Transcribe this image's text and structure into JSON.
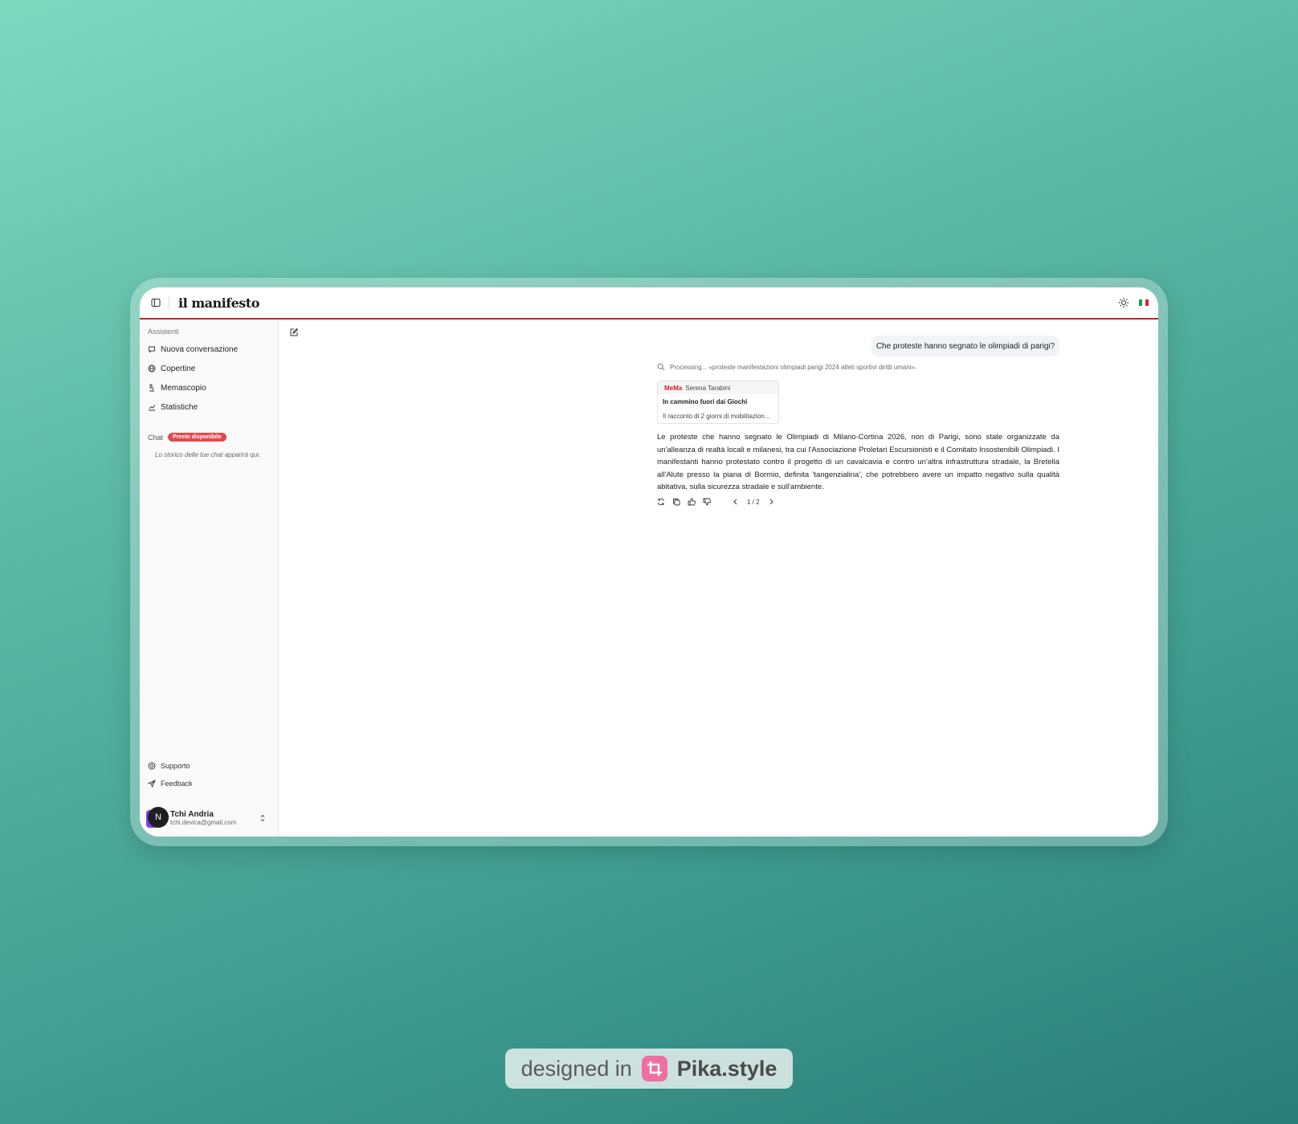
{
  "header": {
    "logo": "il manifesto",
    "flag_colors": [
      "#1b9a4a",
      "#ffffff",
      "#d52b2b"
    ]
  },
  "sidebar": {
    "heading": "Assistenti",
    "items": [
      {
        "label": "Nuova conversazione",
        "icon": "chat-plus-icon"
      },
      {
        "label": "Copertine",
        "icon": "globe-icon"
      },
      {
        "label": "Memascopio",
        "icon": "microscope-icon"
      },
      {
        "label": "Statistiche",
        "icon": "chart-icon"
      }
    ],
    "chat_label": "Chat",
    "chat_badge": "Presto disponibile",
    "empty_note": "Lo storico delle tue chat apparirà qui.",
    "support_label": "Supporto",
    "feedback_label": "Feedback",
    "user": {
      "initial": "N",
      "name": "Tchi Andria",
      "email": "tchi.devica@gmail.com"
    }
  },
  "conversation": {
    "user_message": "Che proteste hanno segnato le olimpiadi di parigi?",
    "processing": "Processing... «proteste manifestazioni olimpiadi parigi 2024 atleti sportivi diritti umani».",
    "source": {
      "publication": "MeMa",
      "author": "Serena Tarabini",
      "title": "In cammino fuori dai Giochi",
      "snippet": "Il racconto di 2 giorni di mobilitazion..."
    },
    "answer": "Le proteste che hanno segnato le Olimpiadi di Milano-Cortina 2026, non di Parigi, sono state organizzate da un'alleanza di realtà locali e milanesi, tra cui l'Associazione Proletari Escursionisti e il Comitato Insostenibili Olimpiadi. I manifestanti hanno protestato contro il progetto di un cavalcavia e contro un'altra infrastruttura stradale, la Bretella all'Alute presso la piana di Bormio, definita 'tangenzialina', che potrebbero avere un impatto negativo sulla qualità abitativa, sulla sicurezza stradale e sull'ambiente.",
    "pager": "1 / 2"
  },
  "credit": {
    "prefix": "designed in",
    "brand": "Pika.style"
  },
  "colors": {
    "accent": "#c8202b",
    "badge": "#e5484d"
  }
}
